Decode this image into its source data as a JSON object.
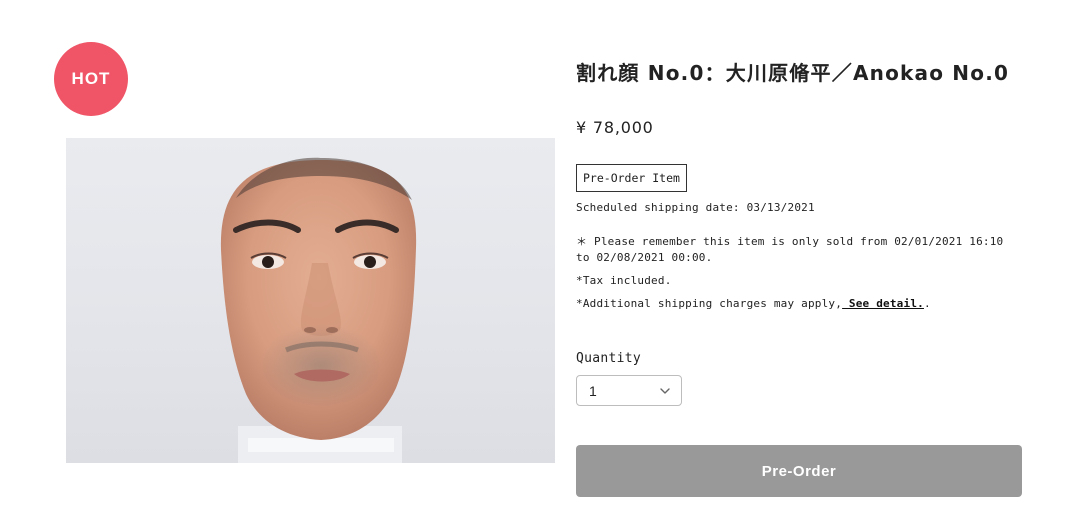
{
  "badge": {
    "text": "HOT",
    "color": "#ef5566"
  },
  "product": {
    "title": "割れ顔 No.0：大川原脩平／Anokao No.0",
    "price": "¥ 78,000",
    "tag": "Pre-Order Item",
    "shipping_date": "Scheduled shipping date: 03/13/2021",
    "notes": [
      "＊ Please remember this item is only sold from 02/01/2021 16:10 to 02/08/2021 00:00.",
      "*Tax included."
    ],
    "shipping_note_prefix": "*Additional shipping charges may apply,",
    "shipping_note_link": " See detail.",
    "shipping_note_suffix": "."
  },
  "quantity": {
    "label": "Quantity",
    "selected": "1"
  },
  "actions": {
    "preorder_label": "Pre-Order",
    "button_color": "#999999"
  },
  "image": {
    "alt": "product-photo-face-mask"
  }
}
